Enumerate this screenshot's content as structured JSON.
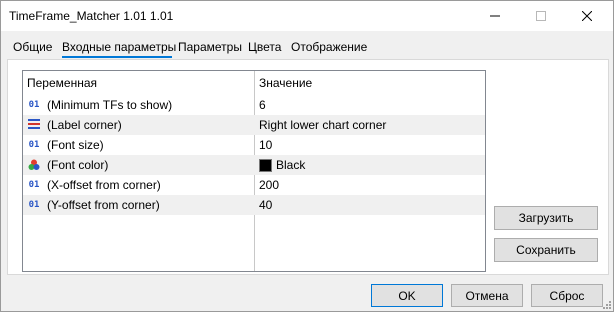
{
  "window": {
    "title": "TimeFrame_Matcher 1.01 1.01"
  },
  "tabs": [
    {
      "label": "Общие"
    },
    {
      "label": "Входные параметры"
    },
    {
      "label": "Параметры"
    },
    {
      "label": "Цвета"
    },
    {
      "label": "Отображение"
    }
  ],
  "active_tab": "Входные параметры",
  "table": {
    "headers": {
      "variable": "Переменная",
      "value": "Значение"
    },
    "rows": [
      {
        "icon": "int-param-icon",
        "variable": "(Minimum TFs to show)",
        "value": "6"
      },
      {
        "icon": "enum-param-icon",
        "variable": "(Label corner)",
        "value": "Right lower chart corner"
      },
      {
        "icon": "int-param-icon",
        "variable": "(Font size)",
        "value": "10"
      },
      {
        "icon": "color-param-icon",
        "variable": "(Font color)",
        "value": "Black",
        "swatch": "#000000"
      },
      {
        "icon": "int-param-icon",
        "variable": "(X-offset from corner)",
        "value": "200"
      },
      {
        "icon": "int-param-icon",
        "variable": "(Y-offset from corner)",
        "value": "40"
      }
    ]
  },
  "side_buttons": {
    "load": "Загрузить",
    "save": "Сохранить"
  },
  "footer": {
    "ok": "OK",
    "cancel": "Отмена",
    "reset": "Сброс"
  },
  "icon_text": {
    "int": "01"
  },
  "colors": {
    "accent": "#0078d7",
    "alt_row": "#f0f0f0",
    "int_icon": "#2a56c6"
  }
}
